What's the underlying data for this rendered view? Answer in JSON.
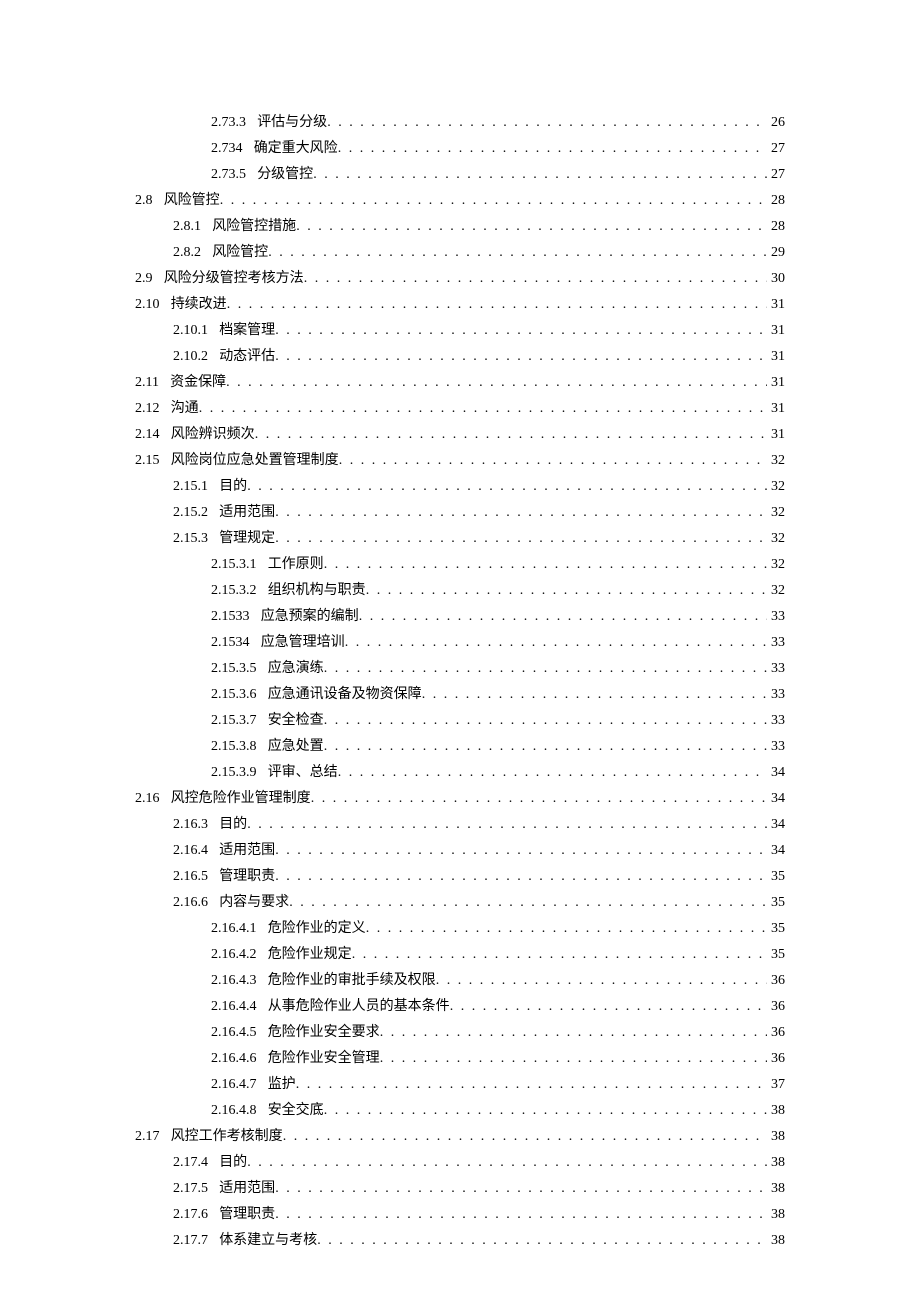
{
  "toc": [
    {
      "level": 3,
      "num": "2.73.3",
      "title": "评估与分级",
      "page": "26"
    },
    {
      "level": 3,
      "num": "2.734",
      "title": "确定重大风险",
      "page": "27"
    },
    {
      "level": 3,
      "num": "2.73.5",
      "title": "分级管控",
      "page": "27"
    },
    {
      "level": 1,
      "num": "2.8",
      "title": "风险管控",
      "page": "28"
    },
    {
      "level": 2,
      "num": "2.8.1",
      "title": "风险管控措施",
      "page": "28"
    },
    {
      "level": 2,
      "num": "2.8.2",
      "title": "风险管控",
      "page": "29"
    },
    {
      "level": 1,
      "num": "2.9",
      "title": "风险分级管控考核方法",
      "page": "30"
    },
    {
      "level": 1,
      "num": "2.10",
      "title": "持续改进",
      "page": "31"
    },
    {
      "level": 2,
      "num": "2.10.1",
      "title": "档案管理",
      "page": "31"
    },
    {
      "level": 2,
      "num": "2.10.2",
      "title": "动态评估",
      "page": "31"
    },
    {
      "level": 1,
      "num": "2.11",
      "title": "资金保障",
      "page": "31"
    },
    {
      "level": 1,
      "num": "2.12",
      "title": "沟通",
      "page": "31"
    },
    {
      "level": 1,
      "num": "2.14",
      "title": "风险辨识频次",
      "page": "31"
    },
    {
      "level": 1,
      "num": "2.15",
      "title": "风险岗位应急处置管理制度",
      "page": "32"
    },
    {
      "level": 2,
      "num": "2.15.1",
      "title": "目的",
      "page": "32"
    },
    {
      "level": 2,
      "num": "2.15.2",
      "title": "适用范围",
      "page": "32"
    },
    {
      "level": 2,
      "num": "2.15.3",
      "title": "管理规定",
      "page": "32"
    },
    {
      "level": 3,
      "num": "2.15.3.1",
      "title": "工作原则",
      "page": "32"
    },
    {
      "level": 3,
      "num": "2.15.3.2",
      "title": "组织机构与职责",
      "page": "32"
    },
    {
      "level": 3,
      "num": "2.1533",
      "title": "应急预案的编制",
      "page": "33"
    },
    {
      "level": 3,
      "num": "2.1534",
      "title": "应急管理培训",
      "page": "33"
    },
    {
      "level": 3,
      "num": "2.15.3.5",
      "title": "应急演练",
      "page": "33"
    },
    {
      "level": 3,
      "num": "2.15.3.6",
      "title": "应急通讯设备及物资保障",
      "page": "33"
    },
    {
      "level": 3,
      "num": "2.15.3.7",
      "title": "安全检查",
      "page": "33"
    },
    {
      "level": 3,
      "num": "2.15.3.8",
      "title": "应急处置",
      "page": "33"
    },
    {
      "level": 3,
      "num": "2.15.3.9",
      "title": "评审、总结",
      "page": "34"
    },
    {
      "level": 1,
      "num": "2.16",
      "title": "风控危险作业管理制度",
      "page": "34"
    },
    {
      "level": 2,
      "num": "2.16.3",
      "title": "目的",
      "page": "34"
    },
    {
      "level": 2,
      "num": "2.16.4",
      "title": "适用范围",
      "page": "34"
    },
    {
      "level": 2,
      "num": "2.16.5",
      "title": "管理职责",
      "page": "35"
    },
    {
      "level": 2,
      "num": "2.16.6",
      "title": "内容与要求",
      "page": "35"
    },
    {
      "level": 3,
      "num": "2.16.4.1",
      "title": "危险作业的定义",
      "page": "35"
    },
    {
      "level": 3,
      "num": "2.16.4.2",
      "title": "危险作业规定",
      "page": "35"
    },
    {
      "level": 3,
      "num": "2.16.4.3",
      "title": "危险作业的审批手续及权限",
      "page": "36"
    },
    {
      "level": 3,
      "num": "2.16.4.4",
      "title": "从事危险作业人员的基本条件",
      "page": "36"
    },
    {
      "level": 3,
      "num": "2.16.4.5",
      "title": "危险作业安全要求",
      "page": "36"
    },
    {
      "level": 3,
      "num": "2.16.4.6",
      "title": "危险作业安全管理",
      "page": "36"
    },
    {
      "level": 3,
      "num": "2.16.4.7",
      "title": "监护",
      "page": "37"
    },
    {
      "level": 3,
      "num": "2.16.4.8",
      "title": "安全交底",
      "page": "38"
    },
    {
      "level": 1,
      "num": "2.17",
      "title": "风控工作考核制度",
      "page": "38"
    },
    {
      "level": 2,
      "num": "2.17.4",
      "title": "目的",
      "page": "38"
    },
    {
      "level": 2,
      "num": "2.17.5",
      "title": "适用范围",
      "page": "38"
    },
    {
      "level": 2,
      "num": "2.17.6",
      "title": "管理职责",
      "page": "38"
    },
    {
      "level": 2,
      "num": "2.17.7",
      "title": "体系建立与考核",
      "page": "38"
    }
  ]
}
